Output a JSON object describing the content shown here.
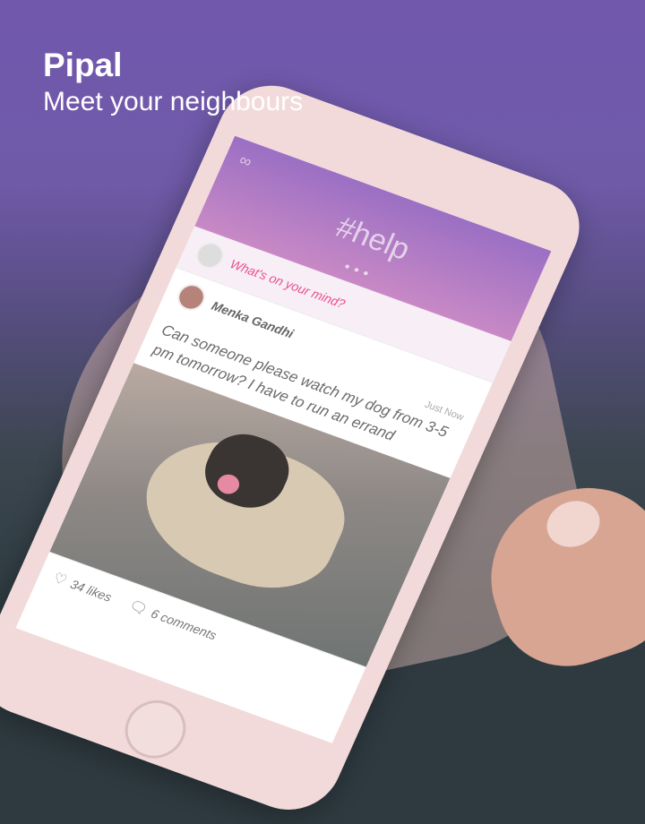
{
  "header": {
    "title": "Pipal",
    "tagline": "Meet your neighbours"
  },
  "app": {
    "header_tag": "#help",
    "compose_placeholder": "What's on your mind?",
    "post": {
      "author": "Menka Gandhi",
      "time": "Just Now",
      "text": "Can someone please watch my dog from 3-5 pm tomorrow? I have to run an errand",
      "likes": "34 likes",
      "comments": "6 comments"
    }
  },
  "icons": {
    "like": "heart-icon",
    "comment": "comment-icon"
  },
  "colors": {
    "accent": "#ec4f8f",
    "background_top": "#7158ad"
  }
}
